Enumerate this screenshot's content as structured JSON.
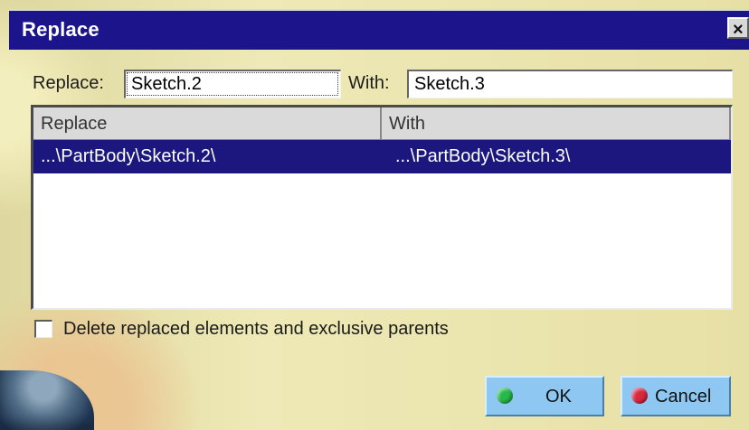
{
  "dialog": {
    "title": "Replace",
    "close_icon": "close-icon"
  },
  "form": {
    "replace_label": "Replace:",
    "replace_value": "Sketch.2",
    "with_label": "With:",
    "with_value": "Sketch.3"
  },
  "table": {
    "headers": [
      "Replace",
      "With"
    ],
    "rows": [
      [
        "...\\PartBody\\Sketch.2\\",
        "...\\PartBody\\Sketch.3\\"
      ]
    ]
  },
  "options": {
    "delete_label": "Delete replaced elements and exclusive parents"
  },
  "buttons": {
    "ok_label": "OK",
    "cancel_label": "Cancel"
  },
  "colors": {
    "title_bar": "#1c148a",
    "selection": "#1b177e",
    "ok_icon": "#27b94a",
    "cancel_icon": "#d8283f",
    "button_face": "#8ec8f2"
  }
}
